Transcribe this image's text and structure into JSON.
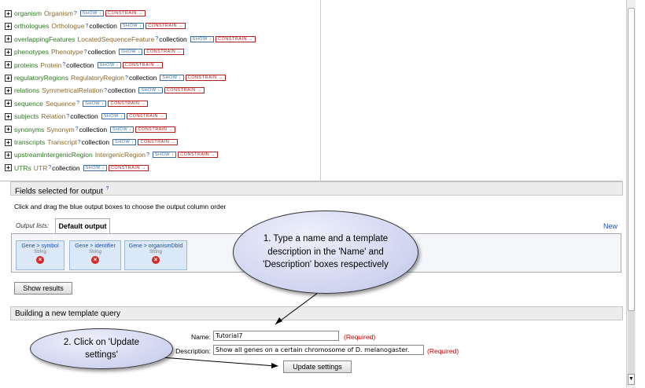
{
  "tree": {
    "show_label": "SHOW ↓",
    "constrain_label": "CONSTRAIN →",
    "help_mark": "?",
    "items": [
      {
        "name": "organism",
        "type": "Organism",
        "collection": ""
      },
      {
        "name": "orthologues",
        "type": "Orthologue",
        "collection": "collection"
      },
      {
        "name": "overlappingFeatures",
        "type": "LocatedSequenceFeature",
        "collection": "collection"
      },
      {
        "name": "phenotypes",
        "type": "Phenotype",
        "collection": "collection"
      },
      {
        "name": "proteins",
        "type": "Protein",
        "collection": "collection"
      },
      {
        "name": "regulatoryRegions",
        "type": "RegulatoryRegion",
        "collection": "collection"
      },
      {
        "name": "relations",
        "type": "SymmetricalRelation",
        "collection": "collection"
      },
      {
        "name": "sequence",
        "type": "Sequence",
        "collection": ""
      },
      {
        "name": "subjects",
        "type": "Relation",
        "collection": "collection"
      },
      {
        "name": "synonyms",
        "type": "Synonym",
        "collection": "collection"
      },
      {
        "name": "transcripts",
        "type": "Transcript",
        "collection": "collection"
      },
      {
        "name": "upstreamIntergenicRegion",
        "type": "IntergenicRegion",
        "collection": ""
      },
      {
        "name": "UTRs",
        "type": "UTR",
        "collection": "collection"
      }
    ]
  },
  "fields_section": {
    "title": "Fields selected for output",
    "help_mark": "?"
  },
  "hint": "Click and drag the blue output boxes to choose the output column order",
  "output": {
    "lists_label": "Output lists:",
    "tab_label": "Default output",
    "new_label": "New",
    "boxes": [
      {
        "path": "Gene > symbol",
        "type": "String"
      },
      {
        "path": "Gene > identifier",
        "type": "String"
      },
      {
        "path": "Gene > organismDbId",
        "type": "String"
      }
    ],
    "show_results_label": "Show results"
  },
  "template_section": {
    "title": "Building a new template query"
  },
  "form": {
    "name_label": "Name:",
    "name_value": "Tutorial7",
    "description_label": "Description:",
    "description_value": "Show all genes on a certain chromosome of D. melanogaster.",
    "required_label": "(Required)",
    "update_label": "Update settings"
  },
  "callouts": {
    "one": "1. Type a name and a template description in the 'Name' and 'Description' boxes respectively",
    "two": "2. Click on 'Update settings'"
  },
  "colors": {
    "field": "#2c7a1f",
    "type": "#8a6a2a",
    "show": "#3a6ea5",
    "constrain": "#b02020",
    "required": "#cc0000",
    "callout": "#cfd4f0"
  }
}
